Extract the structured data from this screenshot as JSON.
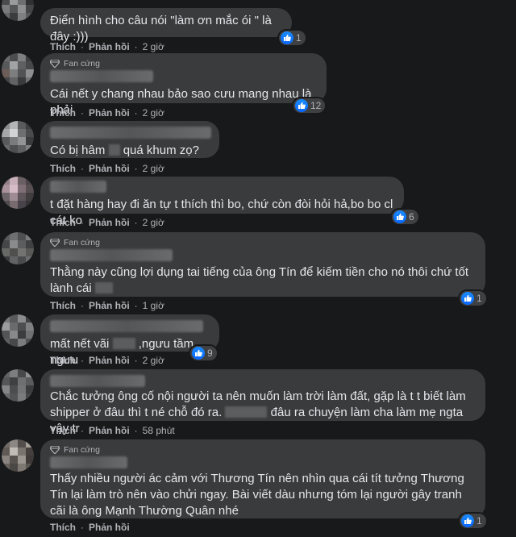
{
  "actions": {
    "like_label": "Thích",
    "reply_label": "Phản hồi",
    "dot": "·"
  },
  "badge": {
    "label": "Fan cứng",
    "icon": "diamond-badge-icon"
  },
  "reaction_icon": "thumbs-up-icon",
  "colors": {
    "background": "#18191a",
    "bubble": "#3a3b3c",
    "text": "#e4e6eb",
    "meta": "#b0b3b8",
    "like_blue": "#1877f2"
  },
  "comments": [
    {
      "text_before": "Điển hình cho câu nói \"làm ơn mắc ói \" là đây :)))",
      "text_after": "",
      "time": "2 giờ",
      "reactions": "1",
      "fan": false
    },
    {
      "text_before": "Cái nết y chang nhau bảo sao cưu mang nhau là phải",
      "text_after": "",
      "time": "2 giờ",
      "reactions": "12",
      "fan": true
    },
    {
      "text_before": "Có bị hâm",
      "text_after": "quá khum zọ?",
      "time": "2 giờ",
      "reactions": "",
      "fan": false
    },
    {
      "text_before": "t đặt hàng hay đi ăn tự t thích thì bo, chứ còn đòi hỏi hả,bo bo cl cát ko",
      "text_after": "",
      "time": "2 giờ",
      "reactions": "6",
      "fan": false
    },
    {
      "text_before": "Thằng này cũng lợi dụng tai tiếng của ông Tín để kiếm tiền cho nó thôi chứ tốt lành cái",
      "text_after": "",
      "time": "1 giờ",
      "reactions": "1",
      "fan": true
    },
    {
      "text_before": "mất nết vãi",
      "text_after": ",ngưu tầm ngưu",
      "time": "2 giờ",
      "reactions": "9",
      "fan": false
    },
    {
      "text_before": "Chắc tưởng ông cố nội người ta nên muốn làm trời làm đất, gặp là t t biết làm shipper ở đâu thì t né chỗ đó ra.",
      "text_after": "đâu ra chuyện làm cha làm mẹ ngta vậy tr",
      "time": "58 phút",
      "reactions": "",
      "fan": false
    },
    {
      "text_before": "Thấy nhiều người ác cảm với Thương Tín nên nhìn qua cái tít tưởng Thương Tín lại làm trò nên vào chửi ngay. Bài viết dàu nhưng tóm lại người gây tranh cãi là ông Mạnh Thường Quân nhé",
      "text_after": "",
      "time": "",
      "reactions": "1",
      "fan": true
    }
  ]
}
